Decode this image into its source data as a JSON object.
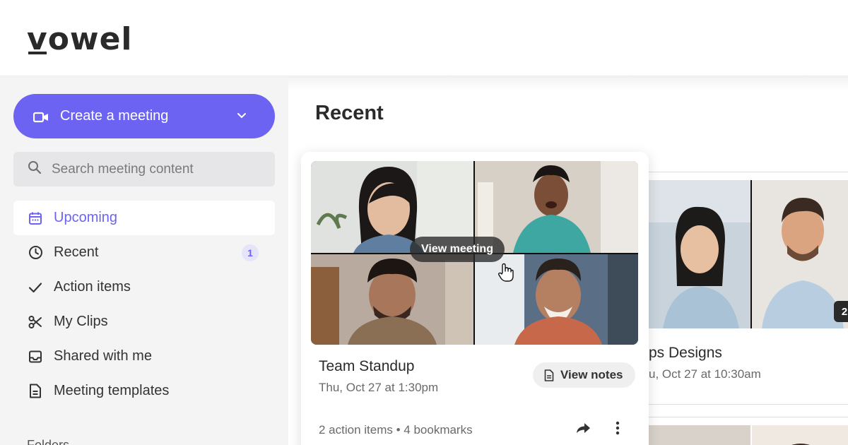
{
  "brand": {
    "logo_text": "vowel"
  },
  "sidebar": {
    "create_label": "Create a meeting",
    "search_placeholder": "Search meeting content",
    "items": [
      {
        "label": "Upcoming",
        "icon": "calendar-icon",
        "active": true
      },
      {
        "label": "Recent",
        "icon": "clock-icon",
        "badge": "1"
      },
      {
        "label": "Action items",
        "icon": "check-icon"
      },
      {
        "label": "My Clips",
        "icon": "scissors-icon"
      },
      {
        "label": "Shared with me",
        "icon": "inbox-icon"
      },
      {
        "label": "Meeting templates",
        "icon": "document-icon"
      }
    ],
    "section_peek": "Folders"
  },
  "main": {
    "title": "Recent",
    "cards": [
      {
        "hover_label": "View meeting",
        "title": "Team Standup",
        "date": "Thu, Oct 27 at 1:30pm",
        "notes_label": "View notes",
        "meta": "2 action items • 4 bookmarks"
      },
      {
        "title": "ps Designs",
        "date": "u, Oct 27 at 10:30am",
        "participant_count": "2"
      }
    ]
  },
  "colors": {
    "accent": "#6c63f2",
    "sidebar_bg": "#f4f4f5",
    "badge_bg": "#e6e4fb"
  }
}
